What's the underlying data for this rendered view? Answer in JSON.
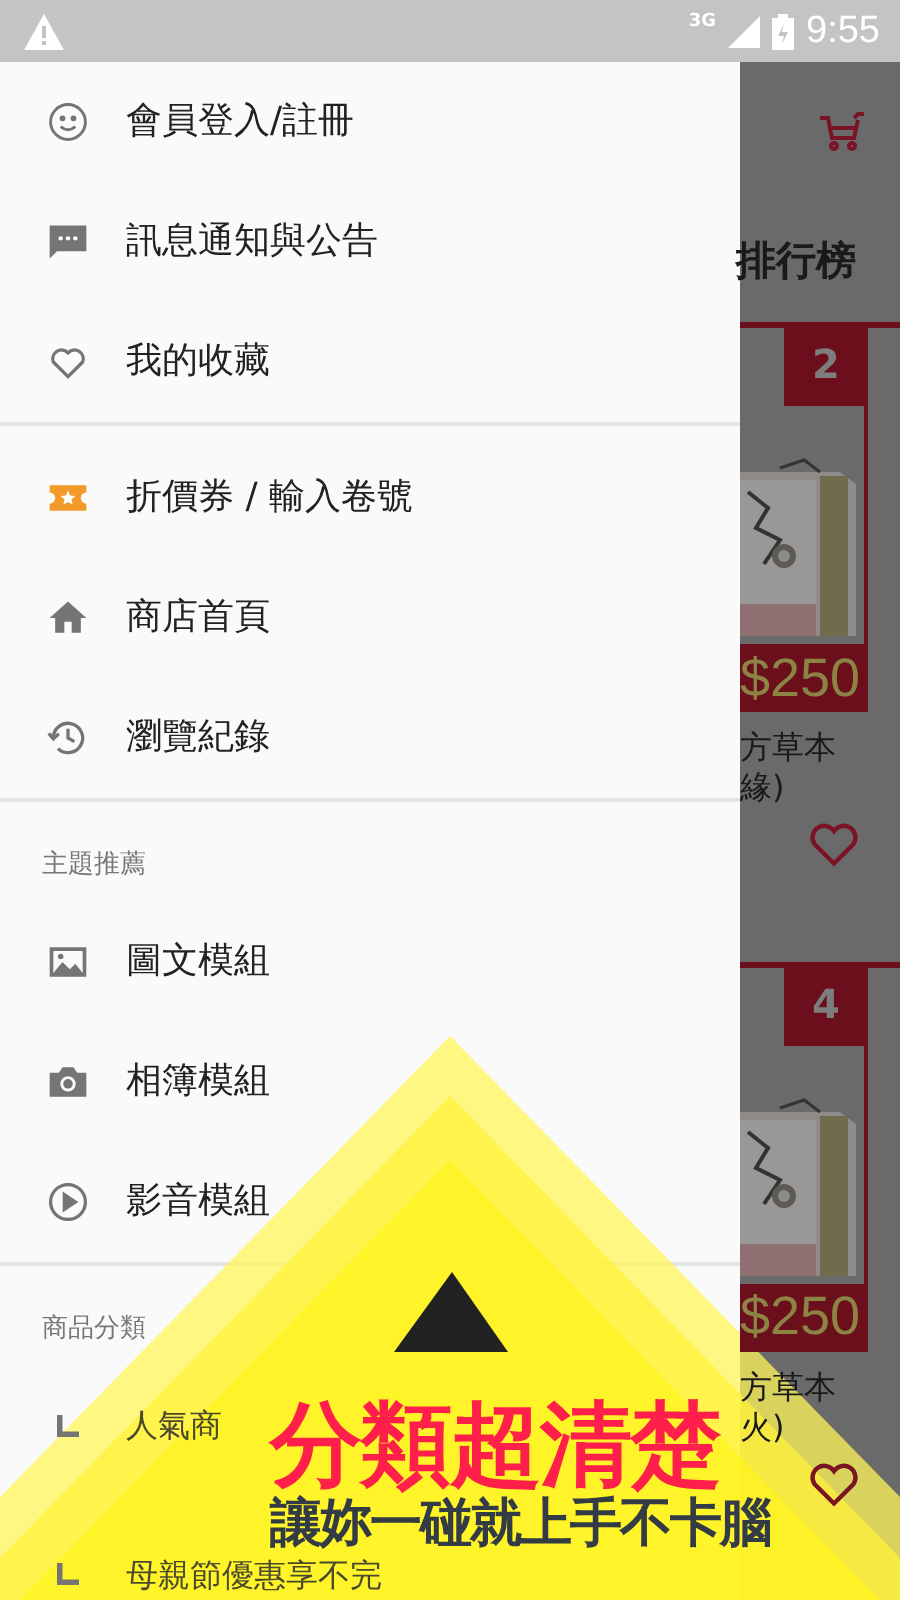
{
  "status_bar": {
    "network": "3G",
    "time": "9:55"
  },
  "drawer": {
    "sections": [
      {
        "items": [
          {
            "label": "會員登入/註冊"
          },
          {
            "label": "訊息通知與公告"
          },
          {
            "label": "我的收藏"
          }
        ]
      },
      {
        "items": [
          {
            "label": "折價券 / 輸入卷號"
          },
          {
            "label": "商店首頁"
          },
          {
            "label": "瀏覽紀錄"
          }
        ]
      },
      {
        "header": "主題推薦",
        "items": [
          {
            "label": "圖文模組"
          },
          {
            "label": "相簿模組"
          },
          {
            "label": "影音模組"
          }
        ]
      },
      {
        "header": "商品分類",
        "items": [
          {
            "label": "人氣商"
          },
          {
            "label": "母親節優惠享不完"
          }
        ]
      }
    ]
  },
  "background_page": {
    "title": "排行榜",
    "products": [
      {
        "rank": "2",
        "price": "$250",
        "name_line_1": "方草本",
        "name_line_2": "緣)"
      },
      {
        "rank": "4",
        "price": "$250",
        "name_line_1": "方草本",
        "name_line_2": "火)"
      }
    ]
  },
  "promo": {
    "headline": "分類超清楚",
    "subline": "讓妳一碰就上手不卡腦"
  }
}
